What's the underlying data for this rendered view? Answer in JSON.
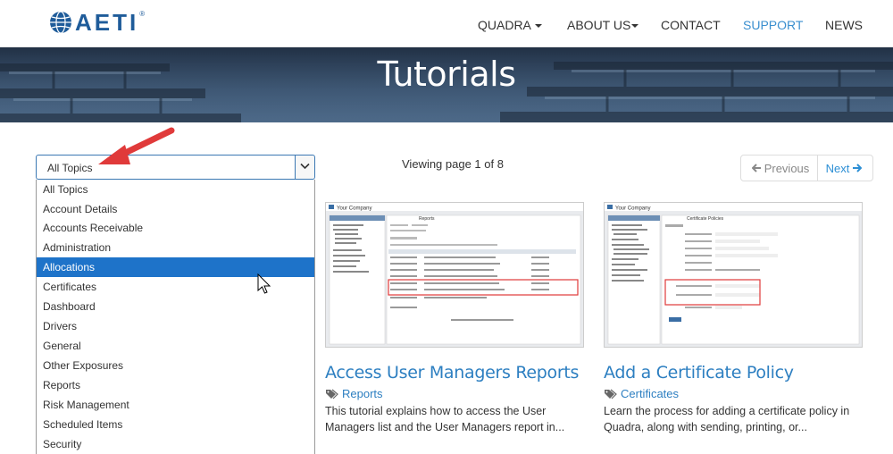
{
  "header": {
    "logo_text": "AETI",
    "logo_reg": "®",
    "nav": [
      {
        "label": "QUADRA",
        "has_caret": true,
        "active": false
      },
      {
        "label": "ABOUT US",
        "has_caret": true,
        "active": false
      },
      {
        "label": "CONTACT",
        "has_caret": false,
        "active": false
      },
      {
        "label": "SUPPORT",
        "has_caret": false,
        "active": true
      },
      {
        "label": "NEWS",
        "has_caret": false,
        "active": false
      }
    ]
  },
  "banner": {
    "title": "Tutorials"
  },
  "topic_select": {
    "value": "All Topics",
    "options": [
      "All Topics",
      "Account Details",
      "Accounts Receivable",
      "Administration",
      "Allocations",
      "Certificates",
      "Dashboard",
      "Drivers",
      "General",
      "Other Exposures",
      "Reports",
      "Risk Management",
      "Scheduled Items",
      "Security"
    ],
    "highlighted": "Allocations"
  },
  "pagination": {
    "viewing_text": "Viewing page 1 of 8",
    "previous_label": "Previous",
    "next_label": "Next"
  },
  "cards": [
    {
      "title": "Access User Managers Reports",
      "tag": "Reports",
      "description": "This tutorial explains how to access the User Managers list and the User Managers report in...",
      "thumb_app": "Your Company",
      "thumb_heading": "Reports"
    },
    {
      "title": "Add a Certificate Policy",
      "tag": "Certificates",
      "description": "Learn the process for adding a certificate policy in Quadra, along with sending, printing, or...",
      "thumb_app": "Your Company",
      "thumb_heading": "Certificate Policies"
    }
  ],
  "colors": {
    "link_blue": "#2d7fc1",
    "nav_active": "#3a8fcf",
    "selected_bg": "#1e73c9",
    "annotation_red": "#e03a3a"
  }
}
